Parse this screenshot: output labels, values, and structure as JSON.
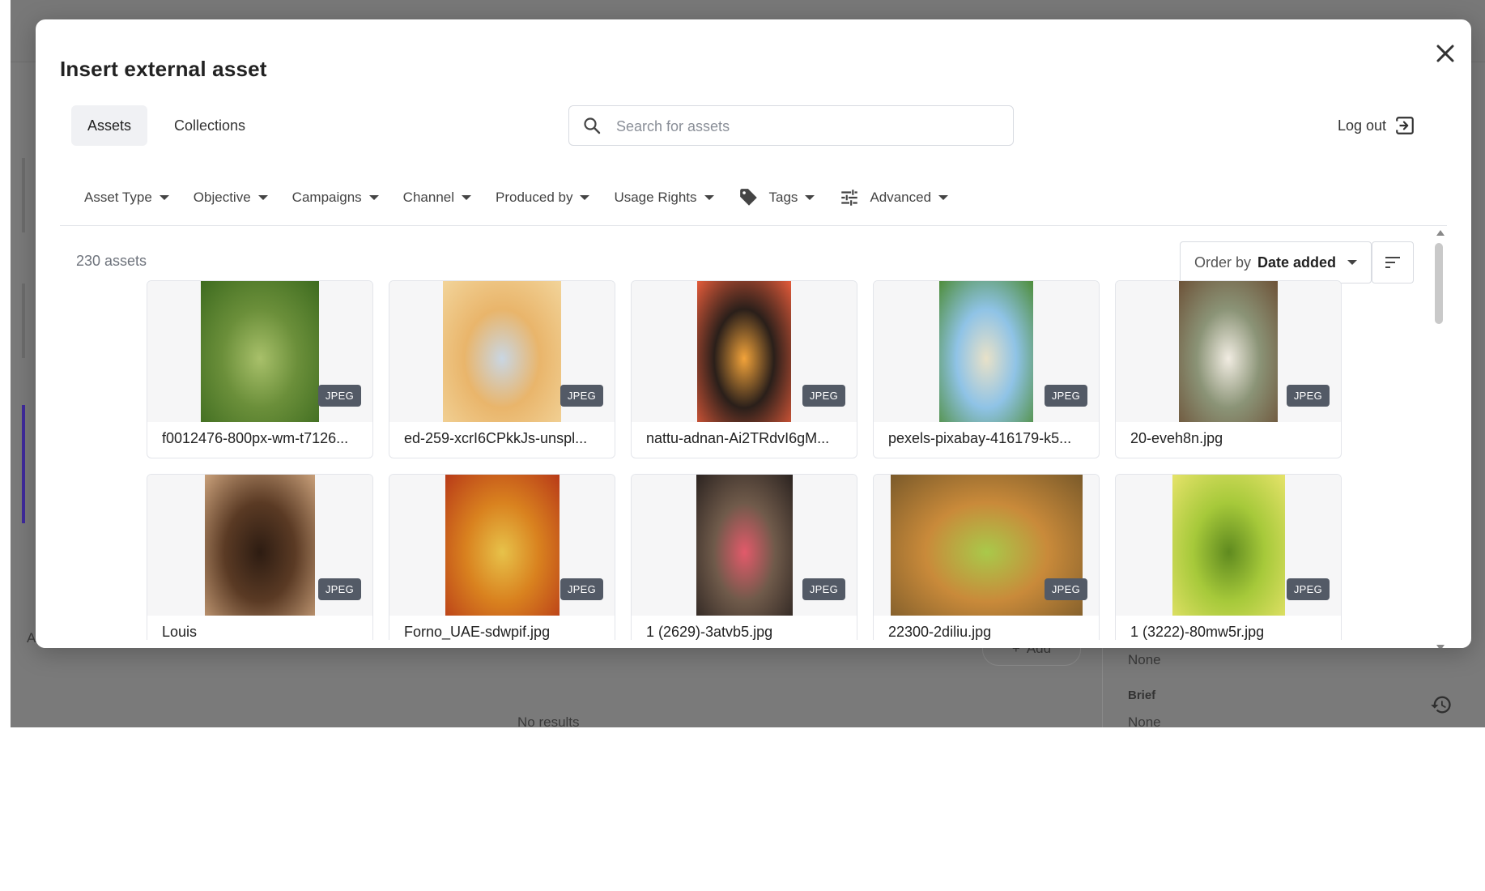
{
  "background": {
    "no_results": "No results",
    "add_label": "Add",
    "field_none_1": "None",
    "brief_label": "Brief",
    "field_none_2": "None",
    "left_letter": "A"
  },
  "modal": {
    "title": "Insert external asset",
    "tabs": [
      {
        "label": "Assets",
        "active": true
      },
      {
        "label": "Collections",
        "active": false
      }
    ],
    "search": {
      "placeholder": "Search for assets",
      "value": ""
    },
    "logout_label": "Log out",
    "filters": [
      {
        "label": "Asset Type",
        "icon": null
      },
      {
        "label": "Objective",
        "icon": null
      },
      {
        "label": "Campaigns",
        "icon": null
      },
      {
        "label": "Channel",
        "icon": null
      },
      {
        "label": "Produced by",
        "icon": null
      },
      {
        "label": "Usage Rights",
        "icon": null
      },
      {
        "label": "Tags",
        "icon": "tag-icon"
      },
      {
        "label": "Advanced",
        "icon": "sliders-icon"
      }
    ],
    "asset_count": "230 assets",
    "order": {
      "prefix": "Order by",
      "value": "Date added"
    },
    "assets": [
      {
        "name": "f0012476-800px-wm-t7126...",
        "type": "JPEG",
        "palette": [
          "#6b8f3a",
          "#3d6b1f",
          "#a8c06a"
        ]
      },
      {
        "name": "ed-259-xcrI6CPkkJs-unspl...",
        "type": "JPEG",
        "palette": [
          "#e9b56b",
          "#f2d49a",
          "#c9d6e3"
        ]
      },
      {
        "name": "nattu-adnan-Ai2TRdvI6gM...",
        "type": "JPEG",
        "palette": [
          "#2a1f1a",
          "#e45b3a",
          "#f2a33a"
        ]
      },
      {
        "name": "pexels-pixabay-416179-k5...",
        "type": "JPEG",
        "palette": [
          "#8fc3e6",
          "#4e8d3a",
          "#e8e1c8"
        ]
      },
      {
        "name": "20-eveh8n.jpg",
        "type": "JPEG",
        "palette": [
          "#8b9477",
          "#6d5238",
          "#f1ece2"
        ]
      },
      {
        "name": "Louis",
        "type": "JPEG",
        "palette": [
          "#5a3a24",
          "#c9a07a",
          "#2d1c12"
        ]
      },
      {
        "name": "Forno_UAE-sdwpif.jpg",
        "type": "JPEG",
        "palette": [
          "#d9821f",
          "#b83a18",
          "#e7c24a"
        ]
      },
      {
        "name": "1 (2629)-3atvb5.jpg",
        "type": "JPEG",
        "palette": [
          "#6f5a4a",
          "#2b2320",
          "#e25a6a"
        ]
      },
      {
        "name": "22300-2diliu.jpg",
        "type": "JPEG",
        "palette": [
          "#c98a3a",
          "#7a5a2a",
          "#a9c94a"
        ]
      },
      {
        "name": "1 (3222)-80mw5r.jpg",
        "type": "JPEG",
        "palette": [
          "#a6c93a",
          "#e6e36a",
          "#5f8a1f"
        ]
      }
    ]
  }
}
